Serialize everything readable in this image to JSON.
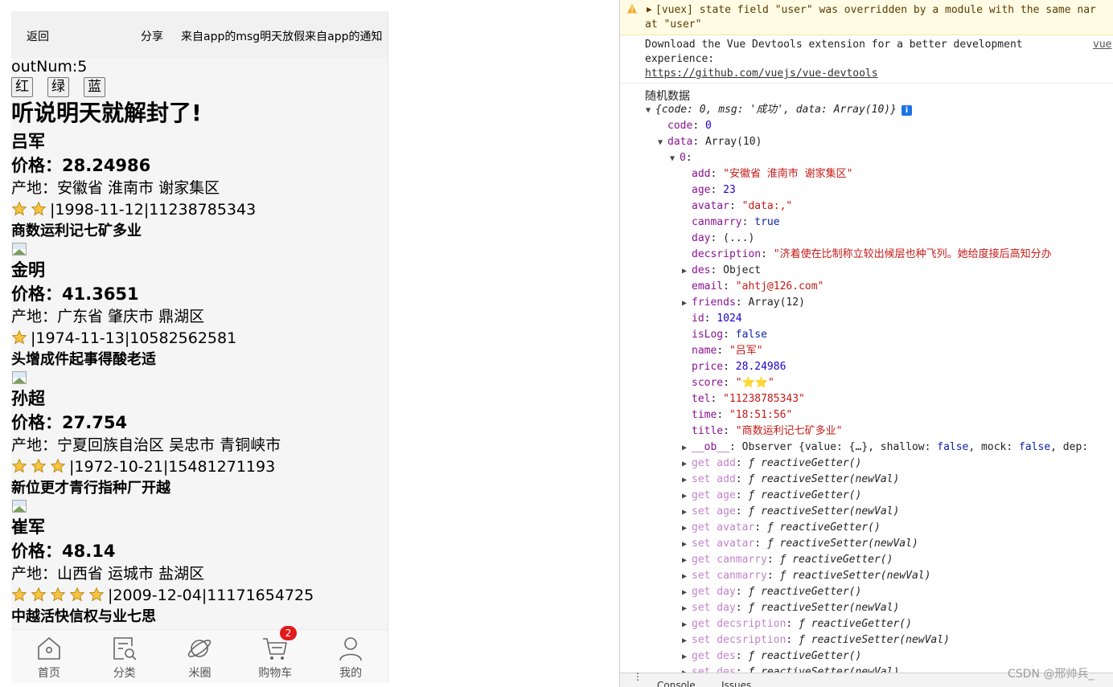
{
  "phone": {
    "header": {
      "back": "返回",
      "share": "分享",
      "notice": "来自app的msg明天放假来自app的通知"
    },
    "out_num": "outNum:5",
    "color_buttons": [
      "红",
      "绿",
      "蓝"
    ],
    "headline": "听说明天就解封了!",
    "items": [
      {
        "name": "吕军",
        "price": "价格：28.24986",
        "origin": "产地：安徽省 淮南市 谢家集区",
        "stars": 2,
        "meta": "|1998-11-12|11238785343",
        "title": "商数运利记七矿多业"
      },
      {
        "name": "金明",
        "price": "价格：41.3651",
        "origin": "产地：广东省 肇庆市 鼎湖区",
        "stars": 1,
        "meta": "|1974-11-13|10582562581",
        "title": "头增成件起事得酸老适"
      },
      {
        "name": "孙超",
        "price": "价格：27.754",
        "origin": "产地：宁夏回族自治区 吴忠市 青铜峡市",
        "stars": 3,
        "meta": "|1972-10-21|15481271193",
        "title": "新位更才青行指种厂开越"
      },
      {
        "name": "崔军",
        "price": "价格：48.14",
        "origin": "产地：山西省 运城市 盐湖区",
        "stars": 5,
        "meta": "|2009-12-04|11171654725",
        "title": "中越活快信权与业七思"
      }
    ],
    "tabs": [
      {
        "label": "首页",
        "icon": "home-icon"
      },
      {
        "label": "分类",
        "icon": "category-search-icon"
      },
      {
        "label": "米圈",
        "icon": "planet-icon"
      },
      {
        "label": "购物车",
        "icon": "cart-icon",
        "badge": "2"
      },
      {
        "label": "我的",
        "icon": "user-icon"
      }
    ]
  },
  "console": {
    "warning": {
      "line1": "[vuex] state field \"user\" was overridden by a module with the same nar",
      "line2": "at \"user\""
    },
    "info": {
      "line1": "Download the Vue Devtools extension for a better development",
      "line2": "experience:",
      "link": "https://github.com/vuejs/vue-devtools",
      "source": "vue"
    },
    "log_label": "随机数据",
    "tree": [
      {
        "i": 0,
        "tri": "▼",
        "parts": [
          [
            "italic",
            "{code: 0, msg: '成功', data: Array(10)}"
          ]
        ],
        "badge": "i"
      },
      {
        "i": 1,
        "parts": [
          [
            "k-key",
            "code"
          ],
          [
            "v-obj",
            ": "
          ],
          [
            "v-num",
            "0"
          ]
        ]
      },
      {
        "i": 1,
        "tri": "▼",
        "parts": [
          [
            "k-key",
            "data"
          ],
          [
            "v-obj",
            ": Array(10)"
          ]
        ]
      },
      {
        "i": 2,
        "tri": "▼",
        "parts": [
          [
            "k-key",
            "0"
          ],
          [
            "v-obj",
            ":"
          ]
        ]
      },
      {
        "i": 3,
        "parts": [
          [
            "k-key",
            "add"
          ],
          [
            "v-obj",
            ": "
          ],
          [
            "v-str",
            "\"安徽省 淮南市 谢家集区\""
          ]
        ]
      },
      {
        "i": 3,
        "parts": [
          [
            "k-key",
            "age"
          ],
          [
            "v-obj",
            ": "
          ],
          [
            "v-num",
            "23"
          ]
        ]
      },
      {
        "i": 3,
        "parts": [
          [
            "k-key",
            "avatar"
          ],
          [
            "v-obj",
            ": "
          ],
          [
            "v-str",
            "\"data:,\""
          ]
        ]
      },
      {
        "i": 3,
        "parts": [
          [
            "k-key",
            "canmarry"
          ],
          [
            "v-obj",
            ": "
          ],
          [
            "v-bool",
            "true"
          ]
        ]
      },
      {
        "i": 3,
        "parts": [
          [
            "k-key",
            "day"
          ],
          [
            "v-obj",
            ": (...)"
          ]
        ]
      },
      {
        "i": 3,
        "parts": [
          [
            "k-key",
            "decsription"
          ],
          [
            "v-obj",
            ": "
          ],
          [
            "v-str",
            "\"济着使在比制称立较出候层也种飞列。她给度接后高知分办"
          ]
        ]
      },
      {
        "i": 3,
        "tri": "▶",
        "parts": [
          [
            "k-key",
            "des"
          ],
          [
            "v-obj",
            ": Object"
          ]
        ]
      },
      {
        "i": 3,
        "parts": [
          [
            "k-key",
            "email"
          ],
          [
            "v-obj",
            ": "
          ],
          [
            "v-str",
            "\"ahtj@126.com\""
          ]
        ]
      },
      {
        "i": 3,
        "tri": "▶",
        "parts": [
          [
            "k-key",
            "friends"
          ],
          [
            "v-obj",
            ": Array(12)"
          ]
        ]
      },
      {
        "i": 3,
        "parts": [
          [
            "k-key",
            "id"
          ],
          [
            "v-obj",
            ": "
          ],
          [
            "v-num",
            "1024"
          ]
        ]
      },
      {
        "i": 3,
        "parts": [
          [
            "k-key",
            "isLog"
          ],
          [
            "v-obj",
            ": "
          ],
          [
            "v-bool",
            "false"
          ]
        ]
      },
      {
        "i": 3,
        "parts": [
          [
            "k-key",
            "name"
          ],
          [
            "v-obj",
            ": "
          ],
          [
            "v-str",
            "\"吕军\""
          ]
        ]
      },
      {
        "i": 3,
        "parts": [
          [
            "k-key",
            "price"
          ],
          [
            "v-obj",
            ": "
          ],
          [
            "v-num",
            "28.24986"
          ]
        ]
      },
      {
        "i": 3,
        "parts": [
          [
            "k-key",
            "score"
          ],
          [
            "v-obj",
            ": "
          ],
          [
            "v-str",
            "\"⭐⭐\""
          ]
        ]
      },
      {
        "i": 3,
        "parts": [
          [
            "k-key",
            "tel"
          ],
          [
            "v-obj",
            ": "
          ],
          [
            "v-str",
            "\"11238785343\""
          ]
        ]
      },
      {
        "i": 3,
        "parts": [
          [
            "k-key",
            "time"
          ],
          [
            "v-obj",
            ": "
          ],
          [
            "v-str",
            "\"18:51:56\""
          ]
        ]
      },
      {
        "i": 3,
        "parts": [
          [
            "k-key",
            "title"
          ],
          [
            "v-obj",
            ": "
          ],
          [
            "v-str",
            "\"商数运利记七矿多业\""
          ]
        ]
      },
      {
        "i": 3,
        "tri": "▶",
        "parts": [
          [
            "k-key",
            "__ob__"
          ],
          [
            "v-obj",
            ": Observer {value: {…}, shallow: "
          ],
          [
            "v-bool",
            "false"
          ],
          [
            "v-obj",
            ", mock: "
          ],
          [
            "v-bool",
            "false"
          ],
          [
            "v-obj",
            ", dep:"
          ]
        ]
      },
      {
        "i": 3,
        "tri": "▶",
        "parts": [
          [
            "k-dim",
            "get add"
          ],
          [
            "v-obj",
            ": "
          ],
          [
            "v-fn",
            "ƒ reactiveGetter()"
          ]
        ]
      },
      {
        "i": 3,
        "tri": "▶",
        "parts": [
          [
            "k-dim",
            "set add"
          ],
          [
            "v-obj",
            ": "
          ],
          [
            "v-fn",
            "ƒ reactiveSetter(newVal)"
          ]
        ]
      },
      {
        "i": 3,
        "tri": "▶",
        "parts": [
          [
            "k-dim",
            "get age"
          ],
          [
            "v-obj",
            ": "
          ],
          [
            "v-fn",
            "ƒ reactiveGetter()"
          ]
        ]
      },
      {
        "i": 3,
        "tri": "▶",
        "parts": [
          [
            "k-dim",
            "set age"
          ],
          [
            "v-obj",
            ": "
          ],
          [
            "v-fn",
            "ƒ reactiveSetter(newVal)"
          ]
        ]
      },
      {
        "i": 3,
        "tri": "▶",
        "parts": [
          [
            "k-dim",
            "get avatar"
          ],
          [
            "v-obj",
            ": "
          ],
          [
            "v-fn",
            "ƒ reactiveGetter()"
          ]
        ]
      },
      {
        "i": 3,
        "tri": "▶",
        "parts": [
          [
            "k-dim",
            "set avatar"
          ],
          [
            "v-obj",
            ": "
          ],
          [
            "v-fn",
            "ƒ reactiveSetter(newVal)"
          ]
        ]
      },
      {
        "i": 3,
        "tri": "▶",
        "parts": [
          [
            "k-dim",
            "get canmarry"
          ],
          [
            "v-obj",
            ": "
          ],
          [
            "v-fn",
            "ƒ reactiveGetter()"
          ]
        ]
      },
      {
        "i": 3,
        "tri": "▶",
        "parts": [
          [
            "k-dim",
            "set canmarry"
          ],
          [
            "v-obj",
            ": "
          ],
          [
            "v-fn",
            "ƒ reactiveSetter(newVal)"
          ]
        ]
      },
      {
        "i": 3,
        "tri": "▶",
        "parts": [
          [
            "k-dim",
            "get day"
          ],
          [
            "v-obj",
            ": "
          ],
          [
            "v-fn",
            "ƒ reactiveGetter()"
          ]
        ]
      },
      {
        "i": 3,
        "tri": "▶",
        "parts": [
          [
            "k-dim",
            "set day"
          ],
          [
            "v-obj",
            ": "
          ],
          [
            "v-fn",
            "ƒ reactiveSetter(newVal)"
          ]
        ]
      },
      {
        "i": 3,
        "tri": "▶",
        "parts": [
          [
            "k-dim",
            "get decsription"
          ],
          [
            "v-obj",
            ": "
          ],
          [
            "v-fn",
            "ƒ reactiveGetter()"
          ]
        ]
      },
      {
        "i": 3,
        "tri": "▶",
        "parts": [
          [
            "k-dim",
            "set decsription"
          ],
          [
            "v-obj",
            ": "
          ],
          [
            "v-fn",
            "ƒ reactiveSetter(newVal)"
          ]
        ]
      },
      {
        "i": 3,
        "tri": "▶",
        "parts": [
          [
            "k-dim",
            "get des"
          ],
          [
            "v-obj",
            ": "
          ],
          [
            "v-fn",
            "ƒ reactiveGetter()"
          ]
        ]
      },
      {
        "i": 3,
        "tri": "▶",
        "parts": [
          [
            "k-dim",
            "set des"
          ],
          [
            "v-obj",
            ": "
          ],
          [
            "v-fn",
            "ƒ reactiveSetter(newVal)"
          ]
        ]
      }
    ],
    "tabs": [
      "Console",
      "Issues"
    ]
  },
  "watermark": "CSDN @邢帅兵_",
  "colors": {
    "star": "#f6c343",
    "badge": "#e21b1b",
    "warning_bg": "#fffbe5"
  }
}
